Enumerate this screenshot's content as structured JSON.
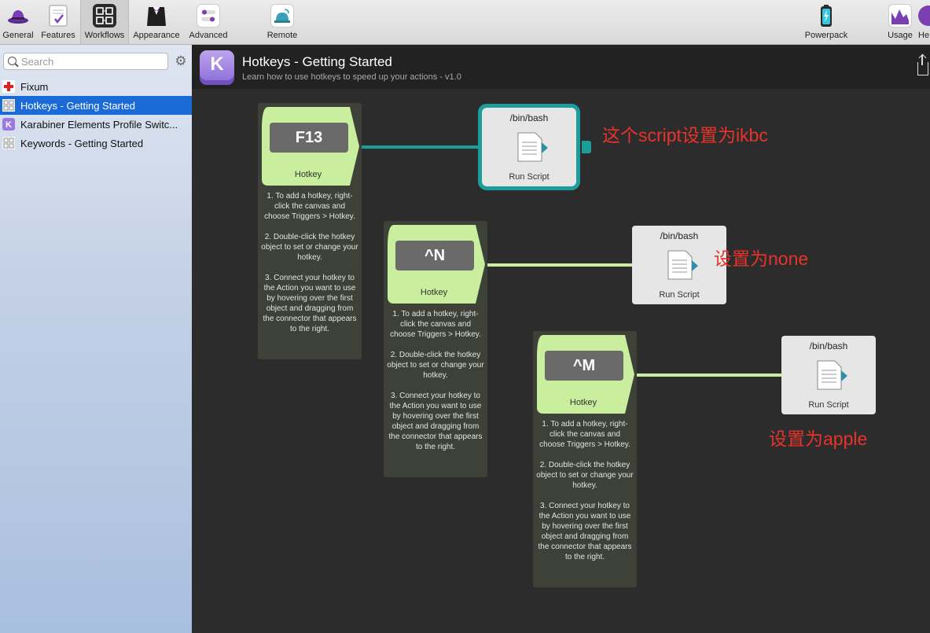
{
  "toolbar": {
    "items": [
      {
        "label": "General",
        "icon": "hat-icon"
      },
      {
        "label": "Features",
        "icon": "checklist-icon"
      },
      {
        "label": "Workflows",
        "icon": "workflows-icon"
      },
      {
        "label": "Appearance",
        "icon": "tuxedo-icon"
      },
      {
        "label": "Advanced",
        "icon": "toggles-icon"
      },
      {
        "label": "Remote",
        "icon": "remote-bell-icon"
      },
      {
        "label": "Powerpack",
        "icon": "battery-icon"
      },
      {
        "label": "Usage",
        "icon": "chart-icon"
      },
      {
        "label": "He",
        "icon": "help-icon"
      }
    ],
    "active": "Workflows"
  },
  "sidebar": {
    "search": {
      "placeholder": "Search",
      "value": ""
    },
    "items": [
      {
        "label": "Fixum",
        "icon": "red-cross-icon",
        "selected": false
      },
      {
        "label": "Hotkeys - Getting Started",
        "icon": "grid-icon",
        "selected": true
      },
      {
        "label": "Karabiner Elements Profile Switc...",
        "icon": "karabiner-k-icon",
        "selected": false
      },
      {
        "label": "Keywords - Getting Started",
        "icon": "grid-icon",
        "selected": false
      }
    ]
  },
  "header": {
    "icon_letter": "K",
    "title": "Hotkeys - Getting Started",
    "subtitle": "Learn how to use hotkeys to speed up your actions - v1.0"
  },
  "canvas": {
    "hotkeys": [
      {
        "key": "F13",
        "label": "Hotkey",
        "notes": [
          "1. To add a hotkey, right-click the canvas and choose Triggers > Hotkey.",
          "2. Double-click the hotkey object to set or change your hotkey.",
          "3. Connect your hotkey to the Action you want to use by hovering over the first object and dragging from the connector that appears to the right."
        ]
      },
      {
        "key": "^N",
        "label": "Hotkey",
        "notes": [
          "1. To add a hotkey, right-click the canvas and choose Triggers > Hotkey.",
          "2. Double-click the hotkey object to set or change your hotkey.",
          "3. Connect your hotkey to the Action you want to use by hovering over the first object and dragging from the connector that appears to the right."
        ]
      },
      {
        "key": "^M",
        "label": "Hotkey",
        "notes": [
          "1. To add a hotkey, right-click the canvas and choose Triggers > Hotkey.",
          "2. Double-click the hotkey object to set or change your hotkey.",
          "3. Connect your hotkey to the Action you want to use by hovering over the first object and dragging from the connector that appears to the right."
        ]
      }
    ],
    "scripts": [
      {
        "title": "/bin/bash",
        "label": "Run Script",
        "selected": true
      },
      {
        "title": "/bin/bash",
        "label": "Run Script",
        "selected": false
      },
      {
        "title": "/bin/bash",
        "label": "Run Script",
        "selected": false
      }
    ],
    "annotations": [
      {
        "text": "这个script设置为ikbc"
      },
      {
        "text": "设置为none"
      },
      {
        "text": "设置为apple"
      }
    ]
  },
  "colors": {
    "hotkey_green": "#c8ee9e",
    "selected_teal": "#1d9c9c",
    "selection_blue": "#1a6ad8",
    "annotation_red": "#e8332a"
  }
}
